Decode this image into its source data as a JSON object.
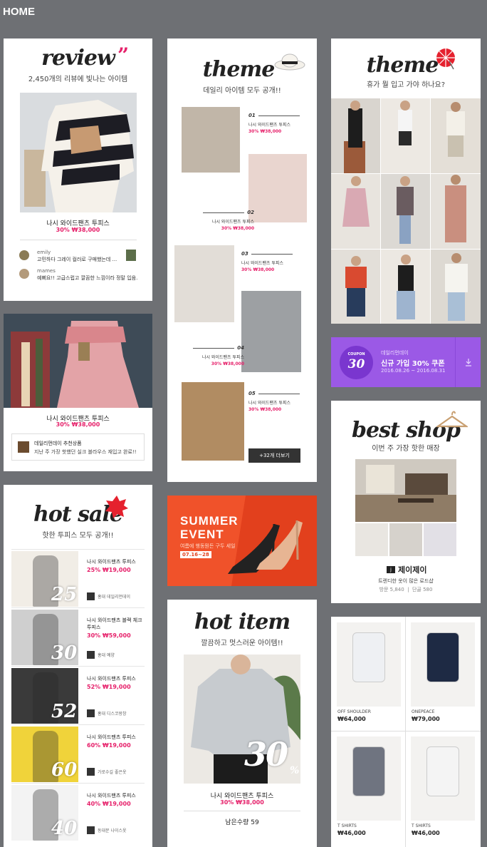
{
  "header": {
    "title": "HOME"
  },
  "review": {
    "title": "review",
    "subtitle": "2,450개의 리뷰에 빛나는 아이템",
    "product": "나시 와이드팬츠 투피스",
    "price": "30% ₩38,000",
    "comments": [
      {
        "user": "emily",
        "text": "고민하다 그레이 컬러로 구매했는데 ..."
      },
      {
        "user": "mames",
        "text": "예뻐요!! 고급스럽고 깔끔한 느낌이라 정말 입음..."
      }
    ]
  },
  "dress_card": {
    "product": "나시 와이드팬츠 투피스",
    "price": "30% ₩38,000",
    "shop": "데일리먼데이 추천상품",
    "desc": "지난 주 가장 핫했던 실크 블라우스 재입고 완료!!"
  },
  "hot_sale": {
    "title": "hot sale",
    "subtitle": "핫한 투피스 모두 공개!!",
    "items": [
      {
        "name": "나시 와이드팬츠 투피스",
        "price": "25% ₩19,000",
        "shop": "홍대 데일리먼데이",
        "pct": "25"
      },
      {
        "name": "나시 와이드팬츠 블랙 체크 투피스",
        "price": "30% ₩59,000",
        "shop": "홍대 예양",
        "pct": "30"
      },
      {
        "name": "나시 와이드팬츠 투피스",
        "price": "52% ₩19,000",
        "shop": "홍대 디스코왕창",
        "pct": "52"
      },
      {
        "name": "나시 와이드팬츠 투피스",
        "price": "60% ₩19,000",
        "shop": "가로수길 좋은옷",
        "pct": "60"
      },
      {
        "name": "나시 와이드팬츠 투피스",
        "price": "40% ₩19,000",
        "shop": "동대문 나이스옷",
        "pct": "40"
      }
    ]
  },
  "theme1": {
    "title": "theme",
    "subtitle": "데일리 아이템 모두 공개!!",
    "items": [
      {
        "no": "01",
        "name": "나시 와이드팬츠 투피스",
        "price": "30% ₩38,000"
      },
      {
        "no": "02",
        "name": "나시 와이드팬츠 투피스",
        "price": "30% ₩38,000"
      },
      {
        "no": "03",
        "name": "나시 와이드팬츠 투피스",
        "price": "30% ₩38,000"
      },
      {
        "no": "04",
        "name": "나시 와이드팬츠 투피스",
        "price": "30% ₩38,000"
      },
      {
        "no": "05",
        "name": "나시 와이드팬츠 투피스",
        "price": "30% ₩38,000"
      }
    ],
    "more": "+32개 더보기"
  },
  "summer": {
    "line1": "SUMMER",
    "line2": "EVENT",
    "desc": "여름에 행동뭔든 구두 세일",
    "date": "07.16~28"
  },
  "hot_item": {
    "title": "hot item",
    "subtitle": "깔끔하고 멋스러운 아이템!!",
    "pct": "30",
    "product": "나시 와이드팬츠 투피스",
    "price": "30% ₩38,000",
    "stock": "남은수량 59"
  },
  "theme2": {
    "title": "theme",
    "subtitle": "휴가 뭘 입고 가야 하나요?"
  },
  "coupon": {
    "badge": "COUPON",
    "value": "30",
    "shop": "데일리먼데이",
    "title": "신규 가입 30% 쿠폰",
    "period": "2016.08.26 ~ 2016.08.31"
  },
  "best_shop": {
    "title": "best shop",
    "subtitle": "이번 주 가장 핫한 매장",
    "logo": "j",
    "name": "제이제이",
    "desc": "트렌디한 옷이 많은 로드샵",
    "stats": "방문 5,840  |  단골 580"
  },
  "products": [
    {
      "cat": "OFF SHOULDER",
      "price": "₩64,000"
    },
    {
      "cat": "ONEPEACE",
      "price": "₩79,000"
    },
    {
      "cat": "T SHIRTS",
      "price": "₩46,000"
    },
    {
      "cat": "T SHIRTS",
      "price": "₩46,000"
    }
  ],
  "colors": {
    "accent": "#e6206a",
    "coupon": "#9b59e6",
    "summer": "#f0522a",
    "bg": "#6e7074"
  }
}
